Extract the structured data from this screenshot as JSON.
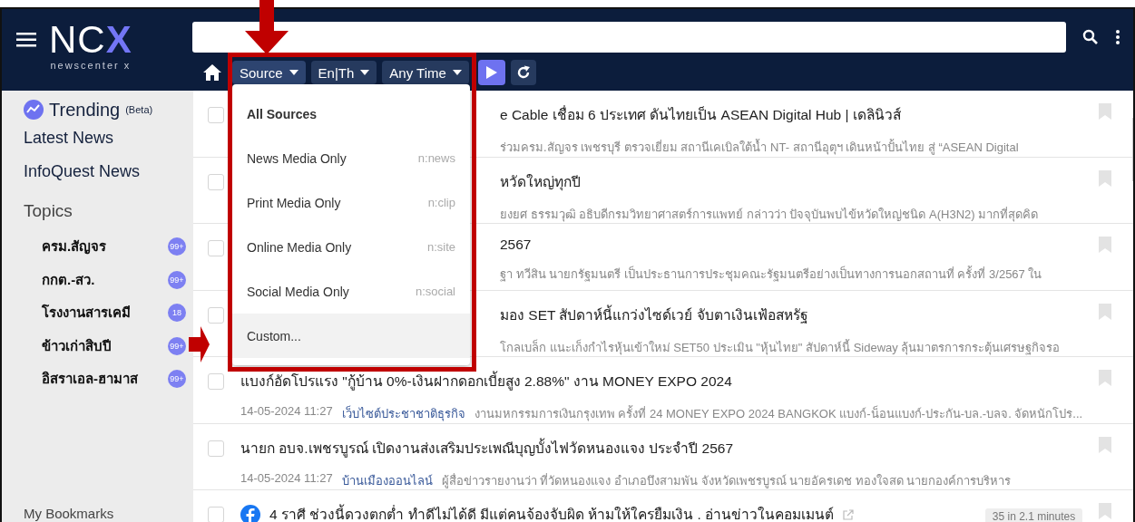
{
  "header": {
    "logo": {
      "main": "NC",
      "accent": "X",
      "tagline": "newscenter x"
    },
    "toolbar": [
      {
        "label": "Source",
        "open": true
      },
      {
        "label": "En|Th",
        "open": false
      },
      {
        "label": "Any Time",
        "open": false
      }
    ]
  },
  "source_menu": [
    {
      "label": "All Sources",
      "selected": true,
      "highlighted": false
    },
    {
      "label": "News Media Only",
      "shortcut": "n:news",
      "selected": false,
      "highlighted": false
    },
    {
      "label": "Print Media Only",
      "shortcut": "n:clip",
      "selected": false,
      "highlighted": false
    },
    {
      "label": "Online Media Only",
      "shortcut": "n:site",
      "selected": false,
      "highlighted": false
    },
    {
      "label": "Social Media Only",
      "shortcut": "n:social",
      "selected": false,
      "highlighted": false
    },
    {
      "label": "Custom...",
      "selected": false,
      "highlighted": true
    }
  ],
  "sidebar": {
    "trending": {
      "label": "Trending",
      "note": "(Beta)"
    },
    "links": [
      "Latest News",
      "InfoQuest News"
    ],
    "topics_heading": "Topics",
    "topics": [
      {
        "name": "ครม.สัญจร",
        "count": "99+"
      },
      {
        "name": "กกต.-สว.",
        "count": "99+"
      },
      {
        "name": "โรงงานสารเคมี",
        "count": "18"
      },
      {
        "name": "ข้าวเก่าสิบปี",
        "count": "99+"
      },
      {
        "name": "อิสราเอล-ฮามาส",
        "count": "99+"
      }
    ],
    "bookmarks": "My Bookmarks"
  },
  "rows": [
    {
      "kind": "covered",
      "checked": false,
      "title": "e Cable เชื่อม 6 ประเทศ ดันไทยเป็น ASEAN Digital Hub | เดลินิวส์",
      "snippet": "ร่วมครม.สัญจร เพชรบุรี ตรวจเยี่ยม สถานีเคเบิลใต้น้ำ NT- สถานีอุตุฯ เดินหน้าปั้นไทย สู่ “ASEAN Digital"
    },
    {
      "kind": "covered",
      "checked": false,
      "title": "หวัดใหญ่ทุกปี",
      "snippet": "ยงยศ ธรรมวุฒิ อธิบดีกรมวิทยาศาสตร์การแพทย์ กล่าวว่า ปัจจุบันพบไข้หวัดใหญ่ชนิด A(H3N2) มากที่สุดคิด"
    },
    {
      "kind": "covered",
      "checked": false,
      "title": "2567",
      "snippet": "ฐา ทวีสิน นายกรัฐมนตรี เป็นประธานการประชุมคณะรัฐมนตรีอย่างเป็นทางการนอกสถานที่ ครั้งที่ 3/2567 ใน"
    },
    {
      "kind": "covered",
      "checked": false,
      "title": "มอง SET สัปดาห์นี้แกว่งไซด์เวย์ จับตาเงินเฟ้อสหรัฐ",
      "snippet": "โกลเบล็ก แนะเก็งกำไรหุ้นเข้าใหม่ SET50 ประเมิน \"หุ้นไทย\" สัปดาห์นี้ Sideway ลุ้นมาตรการกระตุ้นเศรษฐกิจรอ"
    },
    {
      "kind": "full",
      "checked": false,
      "title": "แบงก์อัดโปรแรง \"กู้บ้าน 0%-เงินฝากดอกเบี้ยสูง 2.88%\" งาน MONEY EXPO 2024",
      "date": "14-05-2024  11:27",
      "source": "เว็บไซต์ประชาชาติธุรกิจ",
      "snippet": "งานมหกรรมการเงินกรุงเทพ ครั้งที่ 24 MONEY EXPO 2024 BANGKOK แบงก์-น็อนแบงก์-ประกัน-บล.-บลจ. จัดหนักโปร..."
    },
    {
      "kind": "full",
      "checked": false,
      "title": "นายก อบจ.เพชรบูรณ์ เปิดงานส่งเสริมประเพณีบุญบั้งไฟวัดหนองแจง ประจำปี 2567",
      "date": "14-05-2024  11:27",
      "source": "บ้านเมืองออนไลน์",
      "snippet": "ผู้สื่อข่าวรายงานว่า ที่วัดหนองแจง อำเภอบึงสามพัน จังหวัดเพชรบูรณ์ นายอัครเดช ทองใจสด นายกองค์การบริหาร"
    },
    {
      "kind": "social",
      "checked": false,
      "title": "4 ราศี ช่วงนี้ดวงตกต่ำ ทำดีไม่ได้ดี มีแต่คนจ้องจับผิด ห้ามให้ใครยืมเงิน . อ่านข่าวในคอมเมนต์",
      "badge": "35 in 2.1 minutes"
    }
  ]
}
